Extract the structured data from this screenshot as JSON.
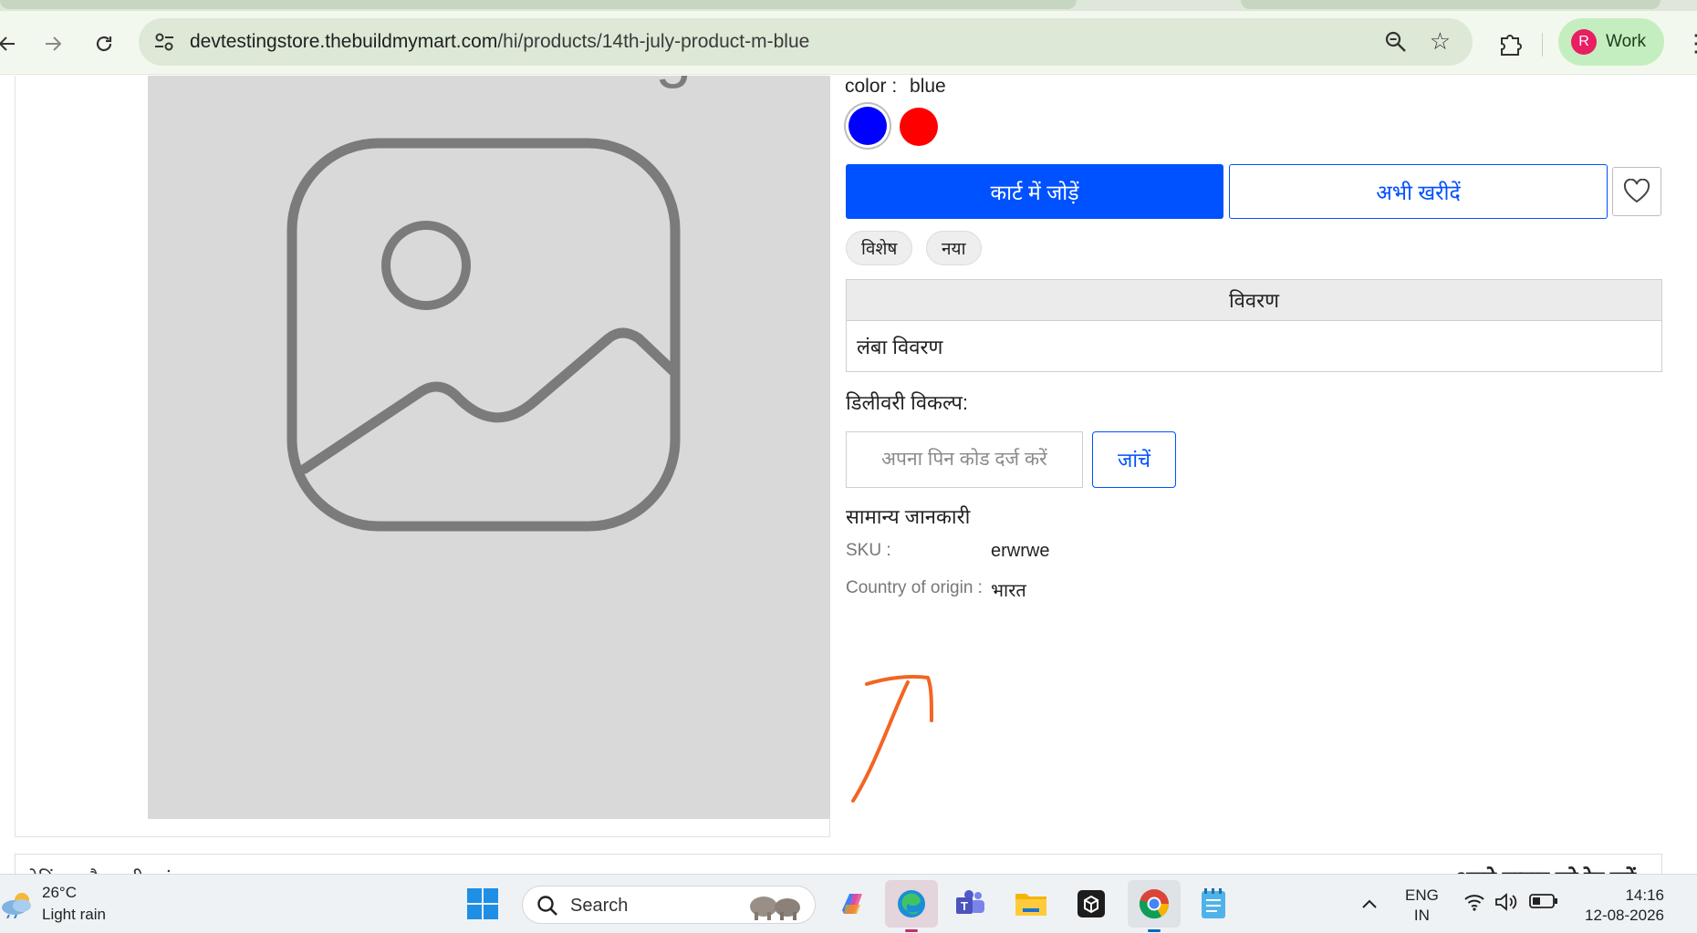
{
  "browser": {
    "url_domain": "devtestingstore.thebuildmymart.com",
    "url_path": "/hi/products/14th-july-product-m-blue",
    "profile_initial": "R",
    "profile_name": "Work",
    "profile_color": "#e91e63"
  },
  "product": {
    "image_watermark": "Product Image",
    "color_label": "color :",
    "color_value": "blue",
    "swatches": [
      {
        "name": "blue",
        "hex": "#0000ff",
        "selected": true
      },
      {
        "name": "red",
        "hex": "#ff0000",
        "selected": false
      }
    ],
    "add_to_cart": "कार्ट में जोड़ें",
    "buy_now": "अभी खरीदें",
    "tags": [
      "विशेष",
      "नया"
    ],
    "description_header": "विवरण",
    "description_body": "लंबा विवरण",
    "delivery_title": "डिलीवरी विकल्प:",
    "pin_placeholder": "अपना पिन कोड दर्ज करें",
    "check_button": "जांचें",
    "general_info_title": "सामान्य जानकारी",
    "sku_label": "SKU :",
    "sku_value": "erwrwe",
    "origin_label": "Country of origin :",
    "origin_value": "भारत"
  },
  "reviews": {
    "left_label": "रेटिंग्स और समीक्षाएं",
    "right_label": "अपने उत्पाद को रेट करें"
  },
  "colors": {
    "primary": "#0051ff",
    "annotation": "#f26522"
  },
  "taskbar": {
    "weather_temp": "26°C",
    "weather_desc": "Light rain",
    "search_label": "Search",
    "lang_top": "ENG",
    "lang_bottom": "IN",
    "time": "14:16",
    "date": "12-08-2026",
    "apps": [
      "start-icon",
      "copilot-icon",
      "edge-icon",
      "teams-icon",
      "file-explorer-icon",
      "box-app-icon",
      "chrome-icon",
      "notepad-icon"
    ]
  }
}
